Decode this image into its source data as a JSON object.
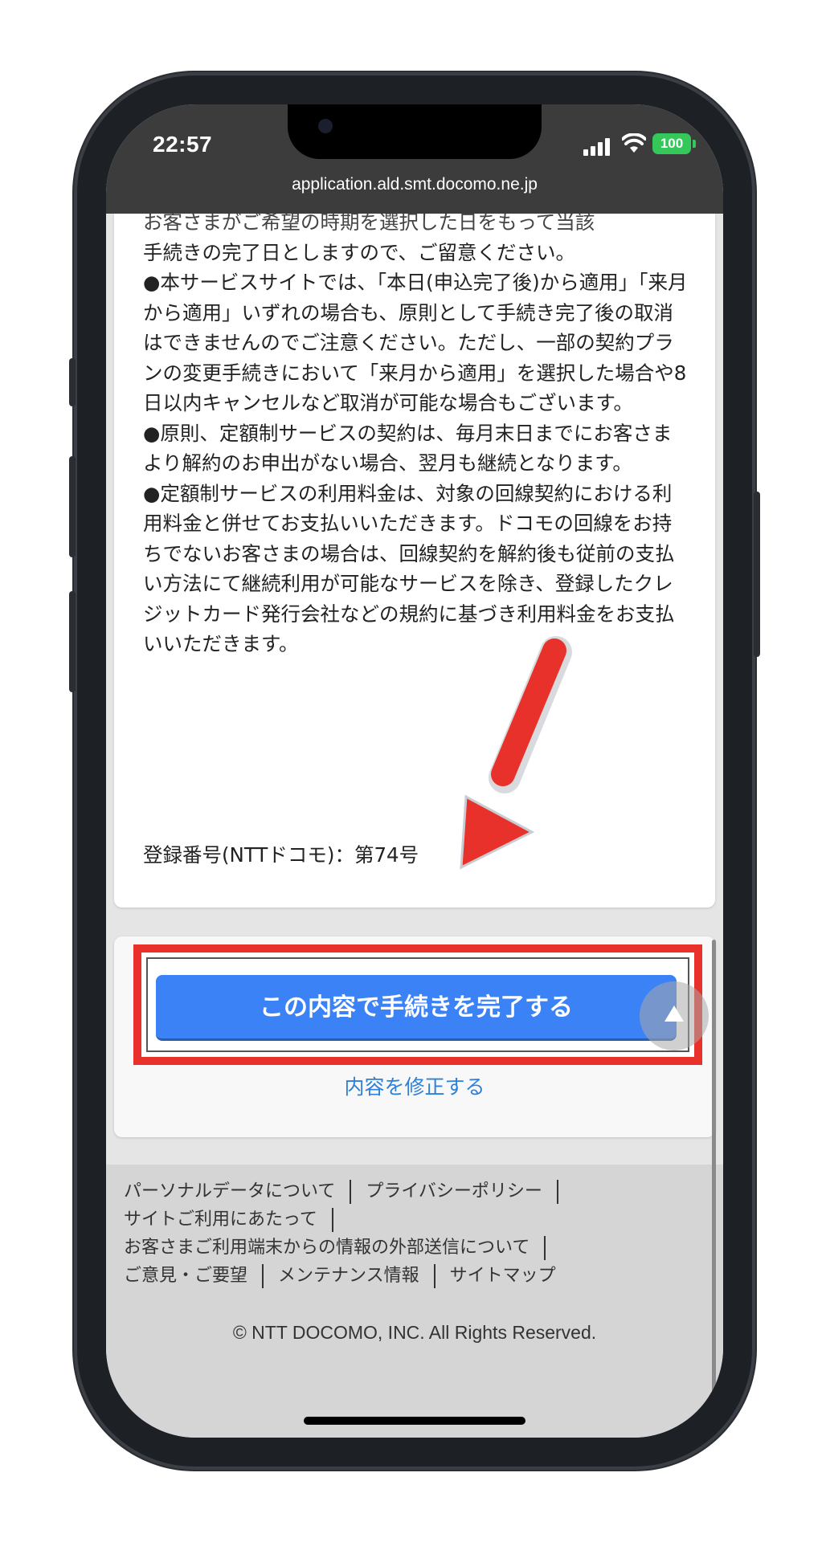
{
  "status": {
    "time": "22:57",
    "battery": "100"
  },
  "browser": {
    "url": "application.ald.smt.docomo.ne.jp"
  },
  "terms": {
    "paragraphs": [
      "お客さまがご希望の時期を選択した日をもって当該",
      "手続きの完了日としますので、ご留意ください。",
      "●本サービスサイトでは、「本日(申込完了後)から適用」「来月から適用」いずれの場合も、原則として手続き完了後の取消はできませんのでご注意ください。ただし、一部の契約プランの変更手続きにおいて「来月から適用」を選択した場合や8日以内キャンセルなど取消が可能な場合もございます。",
      "●原則、定額制サービスの契約は、毎月末日までにお客さまより解約のお申出がない場合、翌月も継続となります。",
      "●定額制サービスの利用料金は、対象の回線契約における利用料金と併せてお支払いいただきます。ドコモの回線をお持ちでないお客さまの場合は、回線契約を解約後も従前の支払い方法にて継続利用が可能なサービスを除き、登録したクレジットカード発行会社などの規約に基づき利用料金をお支払いいただきます。"
    ],
    "registration": "登録番号(NTTドコモ)：第74号"
  },
  "actions": {
    "complete_label": "この内容で手続きを完了する",
    "edit_label": "内容を修正する"
  },
  "footer": {
    "links": {
      "personal_data": "パーソナルデータについて",
      "privacy": "プライバシーポリシー",
      "site_usage": "サイトご利用にあたって",
      "external_transmission": "お客さまご利用端末からの情報の外部送信について",
      "feedback": "ご意見・ご要望",
      "maintenance": "メンテナンス情報",
      "sitemap": "サイトマップ"
    },
    "copyright": "© NTT DOCOMO, INC. All Rights Reserved."
  },
  "colors": {
    "primary_button": "#3b82f6",
    "annotation_red": "#e8312a",
    "link": "#2f80d8"
  }
}
